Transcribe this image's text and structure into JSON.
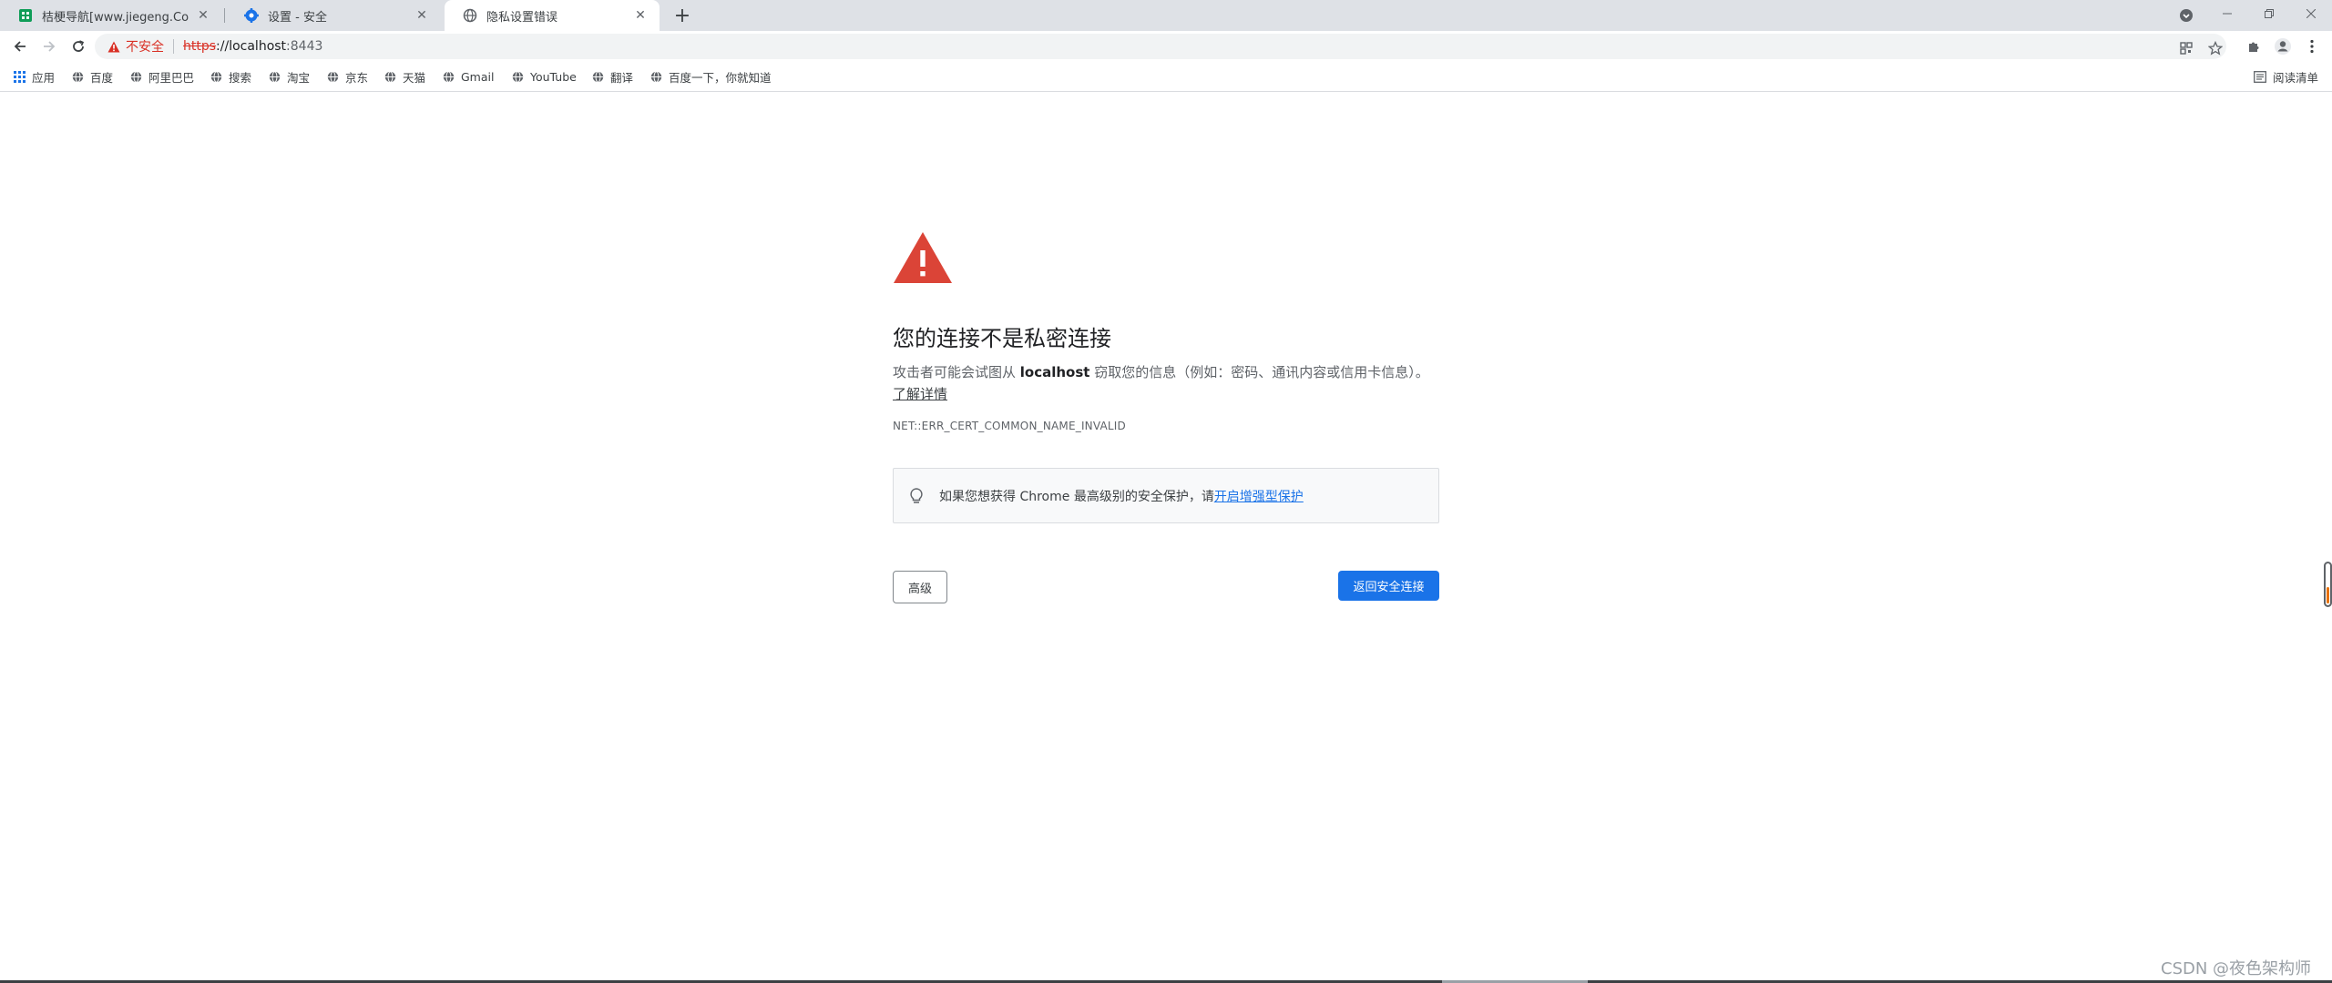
{
  "tabs": [
    {
      "title": "桔梗导航[www.jiegeng.Com]_桔",
      "favicon": "jiegeng-favicon",
      "active": false
    },
    {
      "title": "设置 - 安全",
      "favicon": "settings-gear-icon",
      "active": false
    },
    {
      "title": "隐私设置错误",
      "favicon": "globe-icon",
      "active": true
    }
  ],
  "omnibox": {
    "security_label": "不安全",
    "url_scheme": "https",
    "url_host": "://localhost",
    "url_port": ":8443"
  },
  "bookmarks": {
    "apps_label": "应用",
    "items": [
      "百度",
      "阿里巴巴",
      "搜索",
      "淘宝",
      "京东",
      "天猫",
      "Gmail",
      "YouTube",
      "翻译",
      "百度一下，你就知道"
    ],
    "reading_list": "阅读清单"
  },
  "interstitial": {
    "heading": "您的连接不是私密连接",
    "explanation_pre": "攻击者可能会试图从 ",
    "explanation_host": "localhost",
    "explanation_post": " 窃取您的信息（例如：密码、通讯内容或信用卡信息）。",
    "learn_more": "了解详情",
    "error_code": "NET::ERR_CERT_COMMON_NAME_INVALID",
    "enhanced_text": "如果您想获得 Chrome 最高级别的安全保护，请",
    "enhanced_link": "开启增强型保护",
    "advanced_button": "高级",
    "back_button": "返回安全连接"
  },
  "watermark": "CSDN @夜色架构师",
  "colors": {
    "warning_red": "#d93025",
    "link_blue": "#1a73e8",
    "tabstrip_bg": "#dee1e6"
  }
}
